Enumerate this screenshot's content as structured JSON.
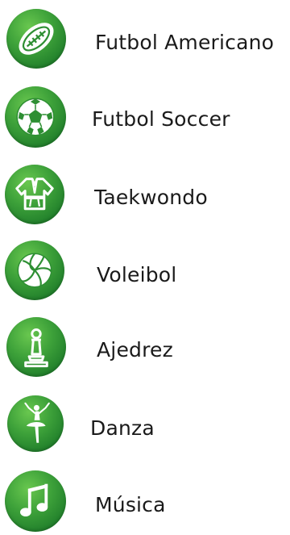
{
  "menu": {
    "items": [
      {
        "label": "Futbol Americano",
        "icon": "american-football-icon"
      },
      {
        "label": "Futbol Soccer",
        "icon": "soccer-ball-icon"
      },
      {
        "label": "Taekwondo",
        "icon": "martial-arts-uniform-icon"
      },
      {
        "label": "Voleibol",
        "icon": "volleyball-icon"
      },
      {
        "label": "Ajedrez",
        "icon": "chess-pawn-icon"
      },
      {
        "label": "Danza",
        "icon": "ballerina-icon"
      },
      {
        "label": "Música",
        "icon": "music-note-icon"
      }
    ]
  },
  "colors": {
    "badge_green_light": "#69c74f",
    "badge_green_dark": "#176b24",
    "label_text": "#1a1a1a"
  }
}
